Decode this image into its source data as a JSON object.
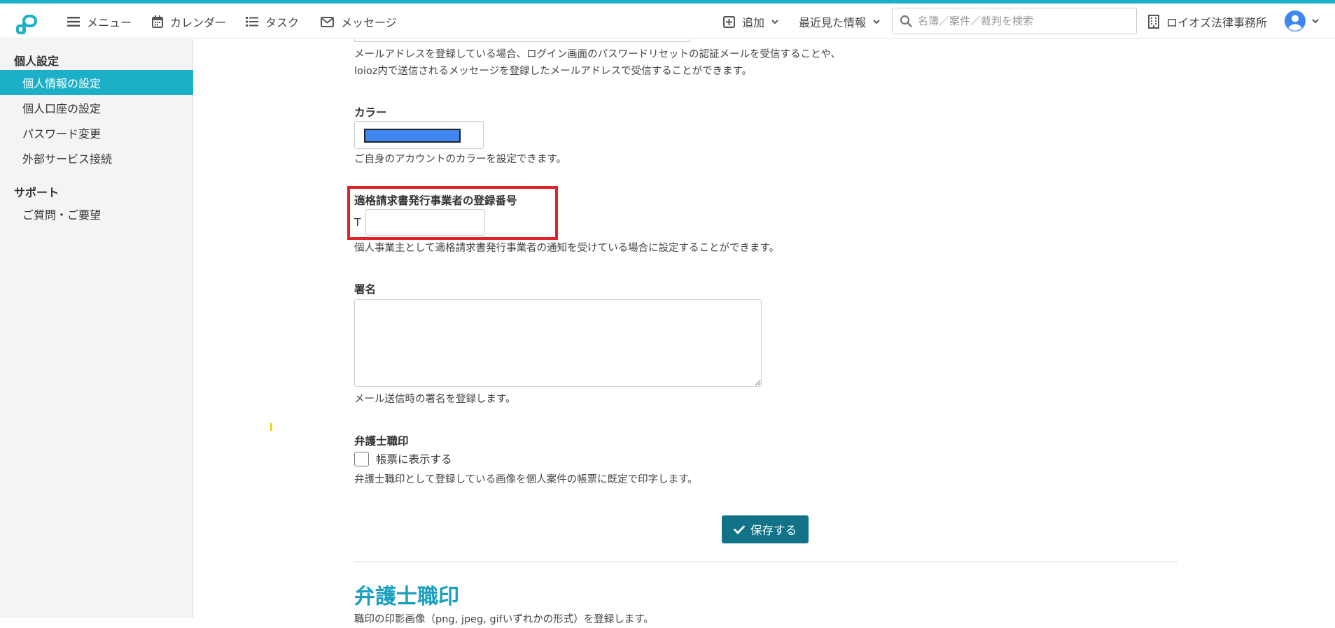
{
  "nav": {
    "menu": "メニュー",
    "calendar": "カレンダー",
    "tasks": "タスク",
    "messages": "メッセージ",
    "add": "追加",
    "recent": "最近見た情報",
    "search_placeholder": "名簿／案件／裁判を検索",
    "office": "ロイオズ法律事務所"
  },
  "sidebar": {
    "personal_heading": "個人設定",
    "items": [
      {
        "label": "個人情報の設定",
        "active": true
      },
      {
        "label": "個人口座の設定",
        "active": false
      },
      {
        "label": "パスワード変更",
        "active": false
      },
      {
        "label": "外部サービス接続",
        "active": false
      }
    ],
    "support_heading": "サポート",
    "support_items": [
      {
        "label": "ご質問・ご要望"
      }
    ]
  },
  "form": {
    "email_help_line1": "メールアドレスを登録している場合、ログイン画面のパスワードリセットの認証メールを受信することや、",
    "email_help_line2": "loioz内で送信されるメッセージを登録したメールアドレスで受信することができます。",
    "color_label": "カラー",
    "color_value": "#3f86f0",
    "color_help": "ご自身のアカウントのカラーを設定できます。",
    "invoice_label": "適格請求書発行事業者の登録番号",
    "invoice_prefix": "T",
    "invoice_value": "",
    "invoice_help": "個人事業主として適格請求書発行事業者の通知を受けている場合に設定することができます。",
    "signature_label": "署名",
    "signature_value": "",
    "signature_help": "メール送信時の署名を登録します。",
    "seal_label": "弁護士職印",
    "seal_checkbox_label": "帳票に表示する",
    "seal_checked": false,
    "seal_help": "弁護士職印として登録している画像を個人案件の帳票に既定で印字します。",
    "save_label": "保存する"
  },
  "seal_section": {
    "title": "弁護士職印",
    "desc": "職印の印影画像（png, jpeg, gifいずれかの形式）を登録します。"
  },
  "colors": {
    "brand": "#1bb0c8",
    "save_button": "#127388",
    "highlight": "#e0232b",
    "section_title": "#1a9fbf"
  }
}
